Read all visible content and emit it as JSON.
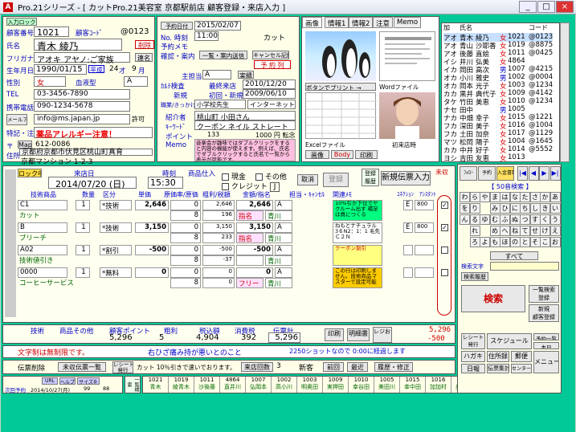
{
  "window": {
    "title": "Pro.21シリーズ  - [ カットPro.21美容室  京都駅前店  顧客登録・来店入力 ]",
    "min": "_",
    "max": "□",
    "close": "×"
  },
  "customer": {
    "in_label": "入力ロック",
    "no_label": "顧客番号",
    "no": "1021",
    "code_label": "顧客ｺｰﾄﾞ",
    "code": "@0123",
    "name_label": "氏名",
    "name": "青木 綾乃",
    "delete_btn": "削除",
    "kana_label": "フリガナ",
    "kana": "アオキ アヤノ:ご家族",
    "kana_btn": "連名",
    "birth_label": "生年月日",
    "birth": "1990/01/15",
    "birth_era": "平成",
    "age_num": "24",
    "age_unit": "才",
    "month": "9",
    "month_unit": "月",
    "sex_label": "性別",
    "sex": "女",
    "blood_label": "血液型",
    "blood": "A",
    "tel_label": "TEL",
    "tel": "03-3456-7890",
    "mobile_label": "携帯電話",
    "mobile": "090-1234-5678",
    "mail_label": "メールアドレス",
    "mail": "info@ms.japan.jp",
    "mail_ok": "許可",
    "note_label": "特記・注意",
    "note": "薬品アレルギー注意！",
    "zip_label": "〒",
    "zip_btn": "Map",
    "zip": "612-0086",
    "addr_label": "住所",
    "addr1": "京都府京都市伏見区桃山町真育",
    "addr2": "京都マンション  1-2-3"
  },
  "visit": {
    "date_label": "予約日付",
    "date": "2015/02/07",
    "time": "11:00",
    "menu": "カット",
    "no_label": "No. 時刻",
    "reserve_label": "予約メモ",
    "staff_label": "確認・案内",
    "list_btn": "一覧・案内送信",
    "cancel_btn": "キャンセル記録",
    "reserve_btn": "予 約 列",
    "main_staff_label": "主担当",
    "main_staff": "A",
    "main_staff_btn": "実績",
    "first_label": "ｶﾙﾃ検査",
    "first_visit_label": "最終来店",
    "first_visit": "2010/12/20",
    "new_label": "新規",
    "first_date_label": "初回・新規",
    "first_date": "2009/06/10",
    "job_label": "職業/きっかけ",
    "job": "小学校先生",
    "job2": "インターネット",
    "intro_label": "紹介者",
    "intro": "桃山町  小田さん",
    "keyword_label": "ｷｰﾜｰﾄﾞ",
    "keyword": "クーポン  ネイル  ストレート",
    "point_label": "ポイント",
    "point": "133",
    "point2": "1000 円 転念",
    "memo_label": "Memo",
    "memo": "音楽会が趣味ではダブルクリックをすると内容の機能が使えます。例えば、氏名でダブルクリックすると氏名で一覧から表示が可能です。"
  },
  "tabs": [
    "画像",
    "情報1",
    "情報2",
    "注意",
    "Memo"
  ],
  "images": {
    "photo_btn": "ボタンでプリント →",
    "word_btn": "Wordファイル",
    "excel_btn": "Excelファイル",
    "first_visit": "初来店時",
    "img_btn": "画像",
    "body_btn": "Body",
    "print_btn": "印刷"
  },
  "staff_list": {
    "header_no": "加",
    "header_name": "氏名",
    "header_code": "コード",
    "rows": [
      [
        "アオ",
        "青木",
        "綾乃",
        "女",
        "1021",
        "@0123"
      ],
      [
        "アオ",
        "青山",
        "沙耶香",
        "女",
        "1019",
        "@8875"
      ],
      [
        "アオ",
        "後藤",
        "直絵",
        "女",
        "1011",
        "@0425"
      ],
      [
        "イシ",
        "井川",
        "弘美",
        "女",
        "4864",
        ""
      ],
      [
        "イカ",
        "岡田",
        "高次",
        "男",
        "1007",
        "@4215"
      ],
      [
        "オカ",
        "小川",
        "雅史",
        "男",
        "1002",
        "@0004"
      ],
      [
        "オカ",
        "岡本",
        "光子",
        "女",
        "1003",
        "@1234"
      ],
      [
        "カカ",
        "黒井",
        "典代子",
        "女",
        "1009",
        "@4142"
      ],
      [
        "タケ",
        "竹田",
        "美恵",
        "女",
        "1010",
        "@1234"
      ],
      [
        "ナセ",
        "田中",
        "",
        "男",
        "1005",
        ""
      ],
      [
        "ナカ",
        "中畑",
        "幸子",
        "女",
        "1015",
        "@1221"
      ],
      [
        "フカ",
        "深田",
        "美子",
        "女",
        "1016",
        "@1004"
      ],
      [
        "フカ",
        "土田",
        "加奈",
        "女",
        "1017",
        "@1129"
      ],
      [
        "マツ",
        "松岡",
        "陽子",
        "女",
        "1004",
        "@1645"
      ],
      [
        "カカ",
        "中井",
        "好子",
        "女",
        "1014",
        "@5552"
      ],
      [
        "ヨシ",
        "吉田",
        "友恵",
        "女",
        "1013",
        ""
      ]
    ]
  },
  "visit_entry": {
    "lock_label": "ロック中",
    "come_label": "来店日",
    "date": "2014/07/20",
    "weekday": "(日)",
    "time_label": "時刻",
    "time": "15:30",
    "stock_label": "商品仕入",
    "pay_cash": "現金",
    "pay_card": "クレジット",
    "pay_other": "その他",
    "pay_j": "J",
    "cancel_btn": "取消",
    "reg_btn": "登録",
    "reg_label": "登録\n履歴",
    "new_slip_btn": "新規伝票入力",
    "unpaid_label": "未収",
    "col_tech": "技術商品",
    "col_qty": "数量",
    "col_div": "区分",
    "col_price": "単価",
    "col_cost": "原価率/原価",
    "col_rate": "粗利/税額",
    "col_amount": "金額/指名",
    "col_staff": "担当・ｷｬﾝｾﾙ",
    "col_memo": "関連ﾒﾓ",
    "col_conn": "ｺﾈｸｼｮﾝ",
    "col_assist": "ｱｼｽﾀﾝﾄ",
    "rows": [
      {
        "code": "C1",
        "name": "カット",
        "qty": "1",
        "div": "*技術",
        "price": "2,646",
        "cost": "0",
        "tax": "8",
        "rate": "2,646",
        "rate2": "196",
        "amount": "2,646",
        "staff": "A",
        "nomi": "指名",
        "staff_name": "青川",
        "cc": "E",
        "assist": "800"
      },
      {
        "code": "B",
        "name": "ブリーチ",
        "qty": "1",
        "div": "*技術",
        "price": "3,150",
        "cost": "0",
        "tax": "8",
        "rate": "3,150",
        "rate2": "233",
        "amount": "3,150",
        "staff": "A",
        "nomi": "指名",
        "staff_name": "青川",
        "cc": "E",
        "assist": "800"
      },
      {
        "code": "A02",
        "name": "技術値引き",
        "qty": "1",
        "div": "*割引",
        "price": "-500",
        "cost": "0",
        "tax": "8",
        "rate": "-500",
        "rate2": "-37",
        "amount": "-500",
        "staff": "A",
        "nomi": "",
        "staff_name": "青川",
        "cc": "",
        "assist": ""
      },
      {
        "code": "0000",
        "name": "コーヒーサービス",
        "qty": "1",
        "div": "*無料",
        "price": "0",
        "cost": "0",
        "tax": "8",
        "rate": "0",
        "rate2": "0",
        "amount": "0",
        "staff": "A",
        "nomi": "フリー",
        "staff_name": "青川",
        "cc": "",
        "assist": ""
      }
    ],
    "memos": [
      "10%引か下位でヤクルーム出す 補足は員につくる",
      "ねもとナチュラル 3６N2：1：1 毛先Ｃ２Ｎ",
      "クーポン割引",
      "この行は印刷しません。技術商品マスターで設定可能"
    ]
  },
  "totals": {
    "tech_label": "技術",
    "prod_label": "商品その他",
    "point_label": "顧客ポイント",
    "gross_label": "粗利",
    "tax_label": "税込額",
    "excise_label": "消費税",
    "total_label": "伝票計",
    "tech": "5",
    "point": "5,296",
    "gross": "4,904",
    "excise": "392",
    "total": "5,296",
    "total_big": "5,296",
    "total_minus": "-500",
    "stamp_btn": "印刷",
    "receipt_btn": "明細書",
    "bill_btn": "レジおつり"
  },
  "status": {
    "msg_label": "スタンプ・注意",
    "msg": "文字制は無制限です。",
    "msg2": "右ひざ痛み持が悪いとのこと",
    "msg3": "2250ショットなので 0:00に経過します",
    "check_label": "伝票削除",
    "check_list": "未収伝票一覧",
    "receipt_btn": "レシート\n発行",
    "cut_notice": "カット 10％引きで速いでおります。",
    "visit_count_label": "来店回数",
    "visit_count": "3",
    "new_label": "新客",
    "prev_btn": "前回",
    "latest_btn": "最近",
    "history_btn": "履歴・修正",
    "url_btn": "URL",
    "help_btn": "ヘルプ",
    "print_btn": "サイズを",
    "next_date_label": "次回予約",
    "next_date": "2014/10/27(月)",
    "n1": "99",
    "n2": "88"
  },
  "bottom_staff": {
    "label": "一覧検索",
    "nums": [
      "1021",
      "1019",
      "1011",
      "4864",
      "1007",
      "1002",
      "1003",
      "1009",
      "1010",
      "1005",
      "1015",
      "1016",
      "1017",
      "1004",
      "1014",
      "1013"
    ],
    "names": [
      "青木",
      "綾青木",
      "沙後藤",
      "直井川",
      "弘岡本",
      "高小川",
      "明奥田",
      "実押田",
      "幸谷田",
      "美田川",
      "幸中田",
      "加加村",
      "美土田",
      "加松岡",
      "裕深",
      "泉美"
    ]
  },
  "right_panel": {
    "search_label": "50音検索",
    "kana_rows": [
      [
        "わ",
        "ら",
        "や",
        "ま",
        "は",
        "な",
        "た",
        "さ",
        "か",
        "あ"
      ],
      [
        "を",
        "り",
        "",
        "み",
        "ひ",
        "に",
        "ち",
        "し",
        "き",
        "い"
      ],
      [
        "ん",
        "る",
        "ゆ",
        "む",
        "ふ",
        "ぬ",
        "つ",
        "す",
        "く",
        "う"
      ],
      [
        "",
        "れ",
        "",
        "め",
        "へ",
        "ね",
        "て",
        "せ",
        "け",
        "え"
      ],
      [
        "",
        "ろ",
        "よ",
        "も",
        "ほ",
        "の",
        "と",
        "そ",
        "こ",
        "お"
      ]
    ],
    "all_btn": "すべて",
    "search_input_label": "検索文字",
    "history_btn": "検索履歴",
    "search_btn": "検索",
    "reserve_list_btn": "一覧検索\n登録",
    "new_reg_btn": "新規\n顧客登録",
    "receipt_btn": "レシート\n発行",
    "schedule_btn": "スケジュール",
    "today_btn": "本日",
    "reserve_btn": "予約一覧",
    "hagaki_btn": "ハガキ",
    "addr_btn": "住所録",
    "post_btn": "郵便",
    "menu_btn": "メニュー",
    "report_btn": "日報",
    "daily_btn": "日計表",
    "slip_btn": "伝票集計",
    "center_btn": "センター連絡",
    "nav": [
      "|◀",
      "◀",
      "▶",
      "▶|"
    ],
    "tiny_btns": [
      "ﾌｫﾛｰ",
      "予約",
      "入金書類"
    ]
  }
}
